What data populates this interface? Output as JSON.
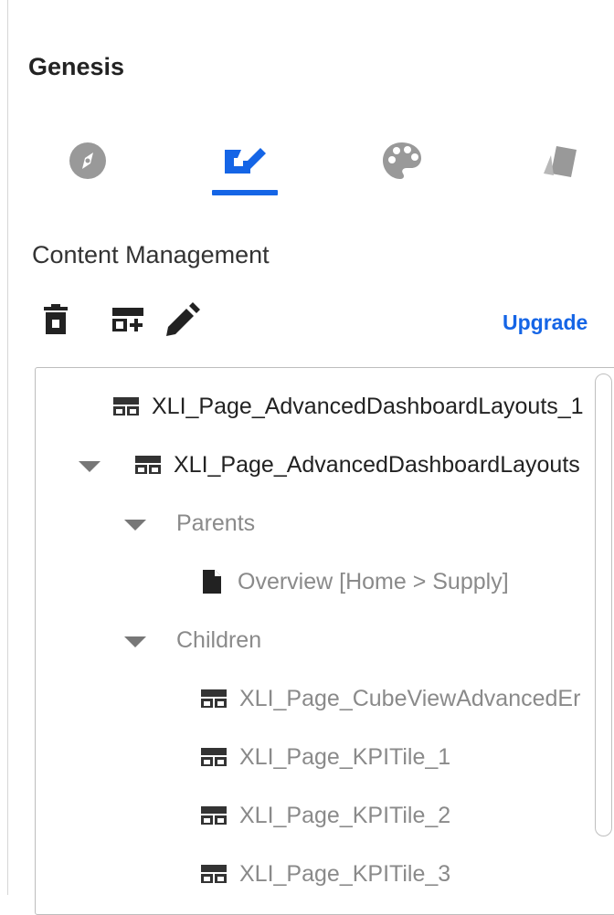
{
  "app": {
    "title": "Genesis"
  },
  "tabs": [
    {
      "name": "explore",
      "icon": "compass-icon",
      "active": false
    },
    {
      "name": "content",
      "icon": "content-edit-icon",
      "active": true
    },
    {
      "name": "theme",
      "icon": "palette-icon",
      "active": false
    },
    {
      "name": "cards",
      "icon": "cards-icon",
      "active": false
    }
  ],
  "section": {
    "title": "Content Management"
  },
  "toolbar": {
    "delete_icon": "trash-icon",
    "add_icon": "add-layout-icon",
    "edit_icon": "pencil-icon",
    "upgrade_label": "Upgrade"
  },
  "tree": {
    "items": [
      {
        "label": "XLI_Page_AdvancedDashboardLayouts_1",
        "icon": "layout-page-icon",
        "expanded": null
      },
      {
        "label": "XLI_Page_AdvancedDashboardLayouts",
        "icon": "layout-page-icon",
        "expanded": true
      },
      {
        "label": "Parents",
        "icon": null,
        "expanded": true
      },
      {
        "label": "Overview [Home > Supply]",
        "icon": "document-icon",
        "expanded": null
      },
      {
        "label": "Children",
        "icon": null,
        "expanded": true
      },
      {
        "label": "XLI_Page_CubeViewAdvancedEr",
        "icon": "layout-page-icon",
        "expanded": null
      },
      {
        "label": "XLI_Page_KPITile_1",
        "icon": "layout-page-icon",
        "expanded": null
      },
      {
        "label": "XLI_Page_KPITile_2",
        "icon": "layout-page-icon",
        "expanded": null
      },
      {
        "label": "XLI_Page_KPITile_3",
        "icon": "layout-page-icon",
        "expanded": null
      }
    ]
  },
  "colors": {
    "accent": "#1565e6",
    "icon_gray": "#999999",
    "icon_dark": "#222222",
    "muted_text": "#8a8a8a"
  }
}
